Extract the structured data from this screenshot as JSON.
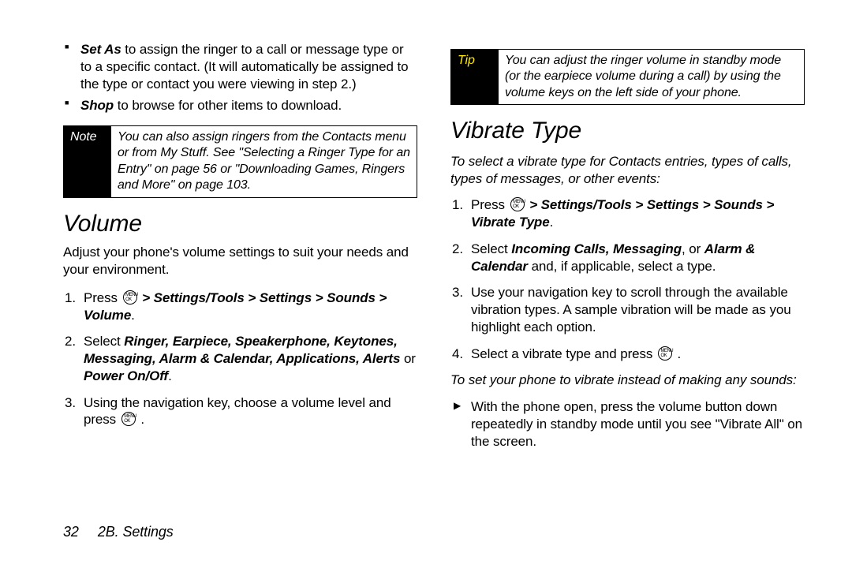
{
  "col1": {
    "bullets": [
      {
        "lead": "Set As",
        "rest": " to assign the ringer to a call or message type or to a specific contact. (It will automatically be assigned to the type or contact you were viewing in step 2.)"
      },
      {
        "lead": "Shop",
        "rest": " to browse for other items to download."
      }
    ],
    "note": {
      "label": "Note",
      "text": "You can also assign ringers from the Contacts menu or from My Stuff. See \"Selecting a Ringer Type for an Entry\" on page 56 or \"Downloading Games, Ringers and More\" on page 103."
    },
    "heading": "Volume",
    "intro": "Adjust your phone's volume settings to suit your needs and your environment.",
    "steps": [
      {
        "num": "1.",
        "pre": "Press ",
        "path": " > Settings/Tools > Settings > Sounds > Volume",
        "post": "."
      },
      {
        "num": "2.",
        "pre": "Select ",
        "strong": "Ringer",
        "rest_strong": ", Earpiece, Speakerphone, Keytones, Messaging, Alarm & Calendar, Applications, Alerts",
        "mid": " or ",
        "last_strong": "Power On/Off",
        "end": "."
      },
      {
        "num": "3.",
        "text": "Using the navigation key, choose a volume level and press ",
        "post": " ."
      }
    ]
  },
  "col2": {
    "tip": {
      "label": "Tip",
      "text": "You can adjust the ringer volume in standby mode (or the earpiece volume during a call) by using the volume keys on the left side of your phone."
    },
    "heading": "Vibrate Type",
    "subintro": "To select a vibrate type for Contacts entries, types of calls, types of messages, or other events:",
    "steps": [
      {
        "num": "1.",
        "pre": "Press ",
        "path": " > Settings/Tools > Settings > Sounds > Vibrate Type",
        "post": "."
      },
      {
        "num": "2.",
        "pre": "Select ",
        "s1": "Incoming Calls, Messaging",
        "mid1": ", or ",
        "s2": "Alarm & Calendar",
        "rest": " and, if applicable, select a type."
      },
      {
        "num": "3.",
        "text": "Use your navigation key to scroll through the available vibration types. A sample vibration will be made as you highlight each option."
      },
      {
        "num": "4.",
        "text": "Select a vibrate type and press ",
        "post": " ."
      }
    ],
    "sub2": "To set your phone to vibrate instead of making any sounds:",
    "arrow": "With the phone open, press the volume button down repeatedly in standby mode until you see \"Vibrate All\" on the screen."
  },
  "footer": {
    "page": "32",
    "section": "2B. Settings"
  }
}
